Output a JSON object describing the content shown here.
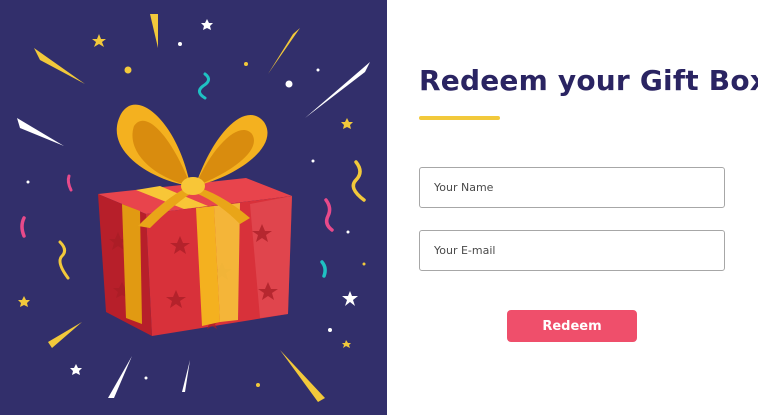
{
  "illustration": {
    "name": "gift-box-illustration",
    "background": "#322f6b",
    "box_color": "#d8313a",
    "ribbon_color": "#f4b11f"
  },
  "form": {
    "title": "Redeem your Gift Box",
    "accent_color": "#f2c93b",
    "name_placeholder": "Your Name",
    "email_placeholder": "Your E-mail",
    "button_label": "Redeem",
    "button_color": "#ef4f6b"
  }
}
